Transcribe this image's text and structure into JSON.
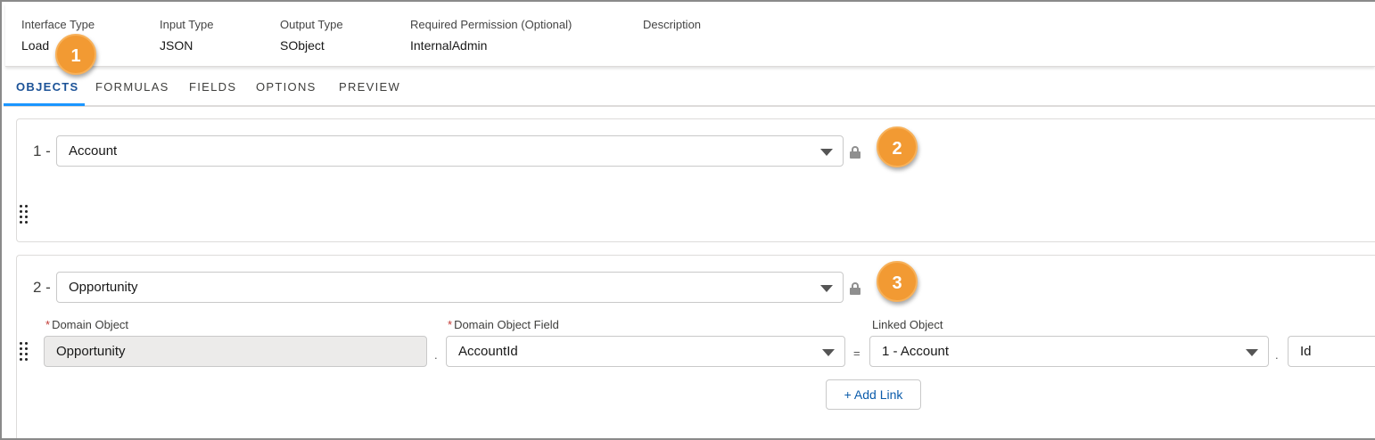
{
  "header": {
    "columns": [
      {
        "label": "Interface Type",
        "value": "Load"
      },
      {
        "label": "Input Type",
        "value": "JSON"
      },
      {
        "label": "Output Type",
        "value": "SObject"
      },
      {
        "label": "Required Permission (Optional)",
        "value": "InternalAdmin"
      },
      {
        "label": "Description",
        "value": ""
      }
    ]
  },
  "tabs": [
    {
      "label": "OBJECTS",
      "active": true
    },
    {
      "label": "FORMULAS",
      "active": false
    },
    {
      "label": "FIELDS",
      "active": false
    },
    {
      "label": "OPTIONS",
      "active": false
    },
    {
      "label": "PREVIEW",
      "active": false
    }
  ],
  "objects": [
    {
      "index": "1 -",
      "selected": "Account"
    },
    {
      "index": "2 -",
      "selected": "Opportunity",
      "link": {
        "domain_object_label": "Domain Object",
        "domain_object_value": "Opportunity",
        "domain_field_label": "Domain Object Field",
        "domain_field_value": "AccountId",
        "linked_object_label": "Linked Object",
        "linked_object_value": "1 - Account",
        "linked_field_value": "Id",
        "dot": ".",
        "equals": "=",
        "required_mark": "*"
      },
      "add_link_label": "+ Add Link"
    }
  ],
  "callouts": [
    "1",
    "2",
    "3"
  ],
  "colors": {
    "accent": "#1b5297",
    "tab_underline": "#1b96ff",
    "callout": "#f29a33",
    "required": "#c23934",
    "link_button_text": "#0b5cab"
  },
  "icons": [
    "lock-icon",
    "drag-handle-icon",
    "chevron-down-icon"
  ]
}
